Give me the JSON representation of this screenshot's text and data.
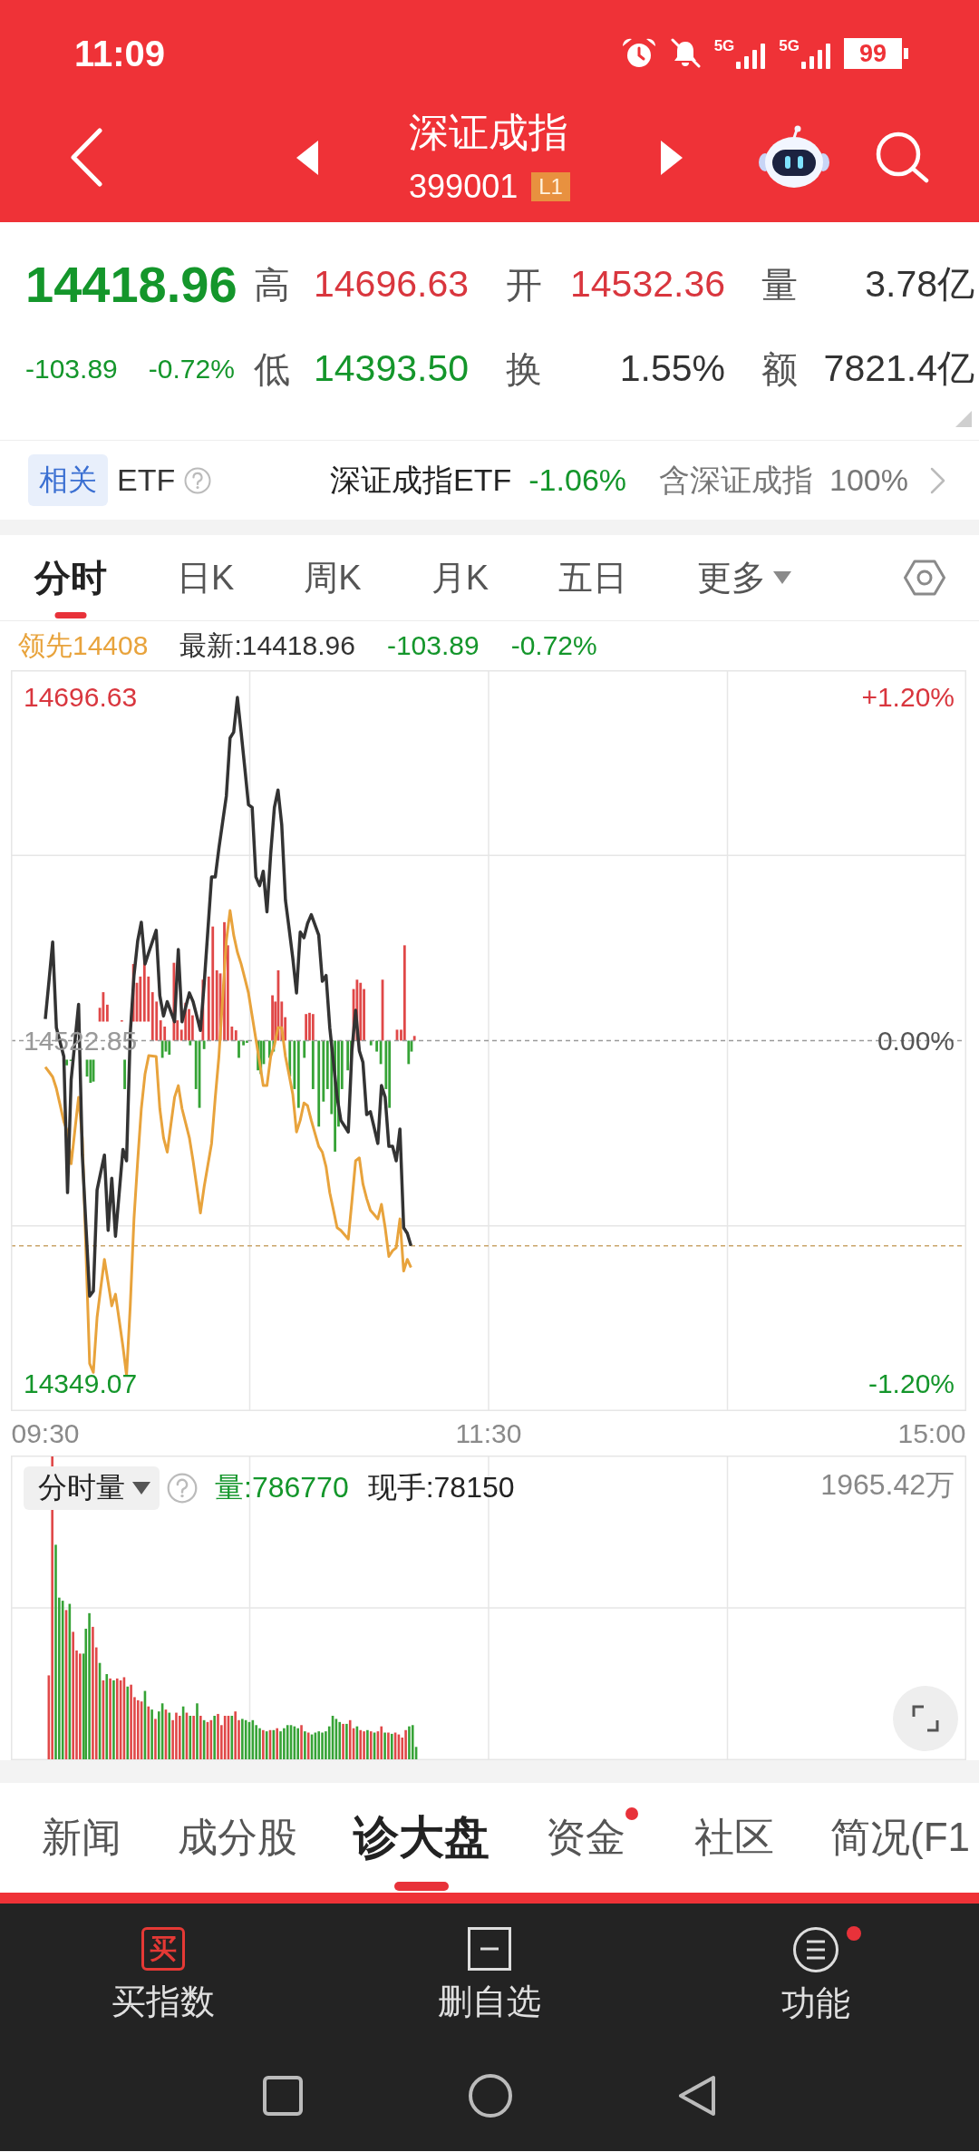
{
  "status_bar": {
    "time": "11:09",
    "network_labels": [
      "5G",
      "5G"
    ],
    "battery": "99"
  },
  "header": {
    "title": "深证成指",
    "code": "399001",
    "badge": "L1"
  },
  "quote": {
    "price": "14418.96",
    "change": "-103.89",
    "change_pct": "-0.72%",
    "falling": true,
    "stats": [
      {
        "label": "高",
        "value": "14696.63",
        "color": "#d9363e"
      },
      {
        "label": "开",
        "value": "14532.36",
        "color": "#d9363e"
      },
      {
        "label": "量",
        "value": "3.78亿",
        "color": "#333333"
      },
      {
        "label": "低",
        "value": "14393.50",
        "color": "#14962b"
      },
      {
        "label": "换",
        "value": "1.55%",
        "color": "#333333"
      },
      {
        "label": "额",
        "value": "7821.4亿",
        "color": "#333333"
      }
    ]
  },
  "etf": {
    "tag": "相关",
    "label": "ETF",
    "name": "深证成指ETF",
    "change": "-1.06%",
    "falling": true,
    "holding_label": "含深证成指",
    "holding": "100%"
  },
  "chart_tabs": [
    {
      "label": "分时",
      "selected": true,
      "dropdown": false
    },
    {
      "label": "日K",
      "selected": false,
      "dropdown": false
    },
    {
      "label": "周K",
      "selected": false,
      "dropdown": false
    },
    {
      "label": "月K",
      "selected": false,
      "dropdown": false
    },
    {
      "label": "五日",
      "selected": false,
      "dropdown": false
    },
    {
      "label": "更多",
      "selected": false,
      "dropdown": true
    }
  ],
  "legend": {
    "lead": "领先14408",
    "latest": "最新:14418.96",
    "change": "-103.89",
    "change_pct": "-0.72%"
  },
  "chart": {
    "chart_data": {
      "type": "line",
      "categories": [
        "09:30",
        null,
        null,
        null,
        null,
        null,
        null,
        null,
        null,
        null,
        null,
        null,
        null,
        null,
        null,
        null,
        null,
        null,
        null,
        null,
        null,
        null,
        null,
        null,
        null,
        null,
        null,
        null,
        null,
        null,
        null,
        null,
        null,
        null,
        null,
        null,
        null,
        null,
        null,
        null,
        null,
        null,
        null,
        null,
        null,
        null,
        null,
        null,
        null,
        null,
        null,
        null,
        null,
        null,
        null,
        null,
        null,
        null,
        null,
        null,
        null,
        null,
        null,
        null,
        null,
        null,
        null,
        null,
        null,
        null,
        null,
        null,
        null,
        null,
        null,
        null,
        null,
        null,
        null,
        null,
        null,
        null,
        null,
        null,
        null,
        null,
        null,
        null,
        null,
        null,
        null,
        null,
        null,
        null,
        null,
        null,
        null,
        null,
        null,
        null,
        null,
        null,
        null,
        null,
        null,
        null,
        null,
        null,
        null,
        null,
        null,
        null,
        null,
        null,
        null,
        null,
        null,
        null,
        null,
        null,
        "11:30",
        null,
        null,
        null,
        null,
        null,
        null,
        null,
        null,
        null,
        null,
        null,
        null,
        null,
        null,
        null,
        null,
        null,
        null,
        null,
        null,
        null,
        null,
        null,
        null,
        null,
        null,
        null,
        null,
        null,
        null,
        null,
        null,
        null,
        null,
        null,
        null,
        null,
        null,
        null,
        null,
        null,
        null,
        null,
        null,
        null,
        null,
        null,
        null,
        null,
        null,
        null,
        null,
        null,
        null,
        null,
        null,
        null,
        null,
        null,
        null,
        null,
        null,
        null,
        null,
        null,
        null,
        null,
        null,
        null,
        null,
        null,
        null,
        null,
        null,
        null,
        null,
        null,
        null,
        null,
        null,
        null,
        null,
        null,
        null,
        null,
        null,
        null,
        null,
        null,
        null,
        null,
        null,
        null,
        null,
        null,
        null,
        null,
        null,
        null,
        null,
        null,
        null,
        null,
        null,
        null,
        null,
        null,
        null,
        null,
        null,
        null,
        null,
        null,
        null,
        null,
        null,
        null,
        null,
        null,
        "15:00"
      ],
      "ylim": [
        14335.3,
        14710.4
      ],
      "yticks": [
        {
          "value": 14696.63,
          "label": "14696.63"
        },
        {
          "value": 14522.85,
          "label": "14522.85"
        },
        {
          "value": 14349.07,
          "label": "14349.07"
        }
      ],
      "series": [
        {
          "color": "#333333",
          "values": [
            14533.8,
            14553.3,
            14572.8,
            14529.4,
            14522.1,
            14514.8,
            14445.9,
            14503.0,
            14522.1,
            14541.2,
            14464.9,
            14429.2,
            14393.5,
            14396.0,
            14447.3,
            14456.1,
            14464.9,
            14426.8,
            14453.2,
            14423.8,
            14445.8,
            14467.8,
            14462.0,
            14526.5,
            14555.8,
            14573.4,
            14582.8,
            14561.7,
            14567.5,
            14573.1,
            14578.7,
            14545.6,
            14535.3,
            14542.6,
            14537.5,
            14532.4,
            14569.0,
            14532.4,
            14539.7,
            14547.0,
            14542.6,
            14535.3,
            14528.0,
            14551.4,
            14578.6,
            14605.7,
            14605.7,
            14620.3,
            14633.5,
            14646.7,
            14676.1,
            14679.0,
            14696.6,
            14679.0,
            14660.7,
            14642.3,
            14640.9,
            14605.7,
            14601.3,
            14608.6,
            14588.1,
            14617.4,
            14640.9,
            14649.7,
            14632.1,
            14594.0,
            14579.3,
            14564.6,
            14547.0,
            14577.8,
            14574.9,
            14582.2,
            14586.6,
            14581.5,
            14576.3,
            14552.9,
            14555.8,
            14529.4,
            14511.8,
            14494.2,
            14482.5,
            14479.6,
            14476.6,
            14517.7,
            14538.2,
            14517.7,
            14511.8,
            14485.4,
            14486.9,
            14478.9,
            14470.8,
            14500.1,
            14494.2,
            14469.3,
            14469.3,
            14462.0,
            14478.1,
            14428.2,
            14425.3,
            14419.0,
            null,
            null,
            null,
            null,
            null,
            null,
            null,
            null,
            null,
            null,
            null,
            null,
            null,
            null,
            null,
            null,
            null,
            null,
            null,
            null,
            null,
            null,
            null,
            null,
            null,
            null,
            null,
            null,
            null,
            null,
            null,
            null,
            null,
            null,
            null,
            null,
            null,
            null,
            null,
            null,
            null,
            null,
            null,
            null,
            null,
            null,
            null,
            null,
            null,
            null,
            null,
            null,
            null,
            null,
            null,
            null,
            null,
            null,
            null,
            null,
            null,
            null,
            null,
            null,
            null,
            null,
            null,
            null,
            null,
            null,
            null,
            null,
            null,
            null,
            null,
            null,
            null,
            null,
            null,
            null,
            null,
            null,
            null,
            null,
            null,
            null,
            null,
            null,
            null,
            null,
            null,
            null,
            null,
            null,
            null,
            null,
            null,
            null,
            null,
            null,
            null,
            null,
            null,
            null,
            null,
            null,
            null,
            null,
            null,
            null,
            null,
            null,
            null,
            null,
            null,
            null,
            null,
            null,
            null,
            null,
            null,
            null,
            null,
            null,
            null,
            null,
            null,
            null,
            null,
            null,
            null,
            null,
            null,
            null,
            null,
            null,
            null,
            null,
            null,
            null,
            null
          ]
        },
        {
          "color": "#e8a33c",
          "values": [
            14509.5,
            14507.0,
            14504.5,
            14498.6,
            14490.3,
            14481.9,
            14476.6,
            14460.5,
            14477.4,
            14494.2,
            14473.7,
            14416.5,
            14359.3,
            14354.9,
            14382.8,
            14397.5,
            14412.1,
            14400.4,
            14388.6,
            14394.5,
            14381.3,
            14368.1,
            14353.4,
            14388.6,
            14432.6,
            14462.0,
            14488.4,
            14506.0,
            14515.3,
            14515.1,
            14514.8,
            14488.4,
            14473.7,
            14466.4,
            14480.3,
            14494.2,
            14500.1,
            14488.4,
            14481.1,
            14473.7,
            14462.0,
            14448.8,
            14435.6,
            14448.8,
            14459.8,
            14470.8,
            14494.2,
            14514.8,
            14544.1,
            14573.4,
            14588.7,
            14576.3,
            14567.6,
            14561.7,
            14554.4,
            14547.0,
            14535.3,
            14523.6,
            14511.8,
            14500.1,
            14500.1,
            14514.8,
            14520.6,
            14529.4,
            14529.4,
            14514.8,
            14505.3,
            14495.7,
            14476.6,
            14482.5,
            14491.3,
            14489.9,
            14482.5,
            14475.9,
            14469.3,
            14466.4,
            14459.0,
            14445.8,
            14437.0,
            14428.2,
            14426.8,
            14424.6,
            14422.4,
            14441.4,
            14462.0,
            14463.5,
            14450.2,
            14442.9,
            14437.0,
            14434.8,
            14432.6,
            14440.0,
            14428.2,
            14413.6,
            14416.5,
            14418.0,
            14432.6,
            14406.2,
            14412.1,
            14408.0,
            null,
            null,
            null,
            null,
            null,
            null,
            null,
            null,
            null,
            null,
            null,
            null,
            null,
            null,
            null,
            null,
            null,
            null,
            null,
            null,
            null,
            null,
            null,
            null,
            null,
            null,
            null,
            null,
            null,
            null,
            null,
            null,
            null,
            null,
            null,
            null,
            null,
            null,
            null,
            null,
            null,
            null,
            null,
            null,
            null,
            null,
            null,
            null,
            null,
            null,
            null,
            null,
            null,
            null,
            null,
            null,
            null,
            null,
            null,
            null,
            null,
            null,
            null,
            null,
            null,
            null,
            null,
            null,
            null,
            null,
            null,
            null,
            null,
            null,
            null,
            null,
            null,
            null,
            null,
            null,
            null,
            null,
            null,
            null,
            null,
            null,
            null,
            null,
            null,
            null,
            null,
            null,
            null,
            null,
            null,
            null,
            null,
            null,
            null,
            null,
            null,
            null,
            null,
            null,
            null,
            null,
            null,
            null,
            null,
            null,
            null,
            null,
            null,
            null,
            null,
            null,
            null,
            null,
            null,
            null,
            null,
            null,
            null,
            null,
            null,
            null,
            null,
            null,
            null,
            null,
            null,
            null,
            null,
            null,
            null,
            null,
            null,
            null,
            null,
            null,
            null
          ]
        }
      ]
    },
    "right_labels": [
      "+1.20%",
      "0.00%",
      "-1.20%"
    ]
  },
  "volume": {
    "selector": "分时量",
    "volume": "量:786770",
    "falling": true,
    "current": "现手:78150",
    "max_label": "1965.42万"
  },
  "bottom_tabs": [
    {
      "label": "新闻",
      "selected": false,
      "dot": false
    },
    {
      "label": "成分股",
      "selected": false,
      "dot": false
    },
    {
      "label": "诊大盘",
      "selected": true,
      "dot": false
    },
    {
      "label": "资金",
      "selected": false,
      "dot": true
    },
    {
      "label": "社区",
      "selected": false,
      "dot": false
    },
    {
      "label": "简况(F1",
      "selected": false,
      "dot": false
    }
  ],
  "actions": [
    {
      "kind": "buy",
      "icon_text": "买",
      "label": "买指数",
      "dot": false
    },
    {
      "kind": "remove",
      "label": "删自选",
      "dot": false
    },
    {
      "kind": "menu",
      "label": "功能",
      "dot": true
    }
  ]
}
